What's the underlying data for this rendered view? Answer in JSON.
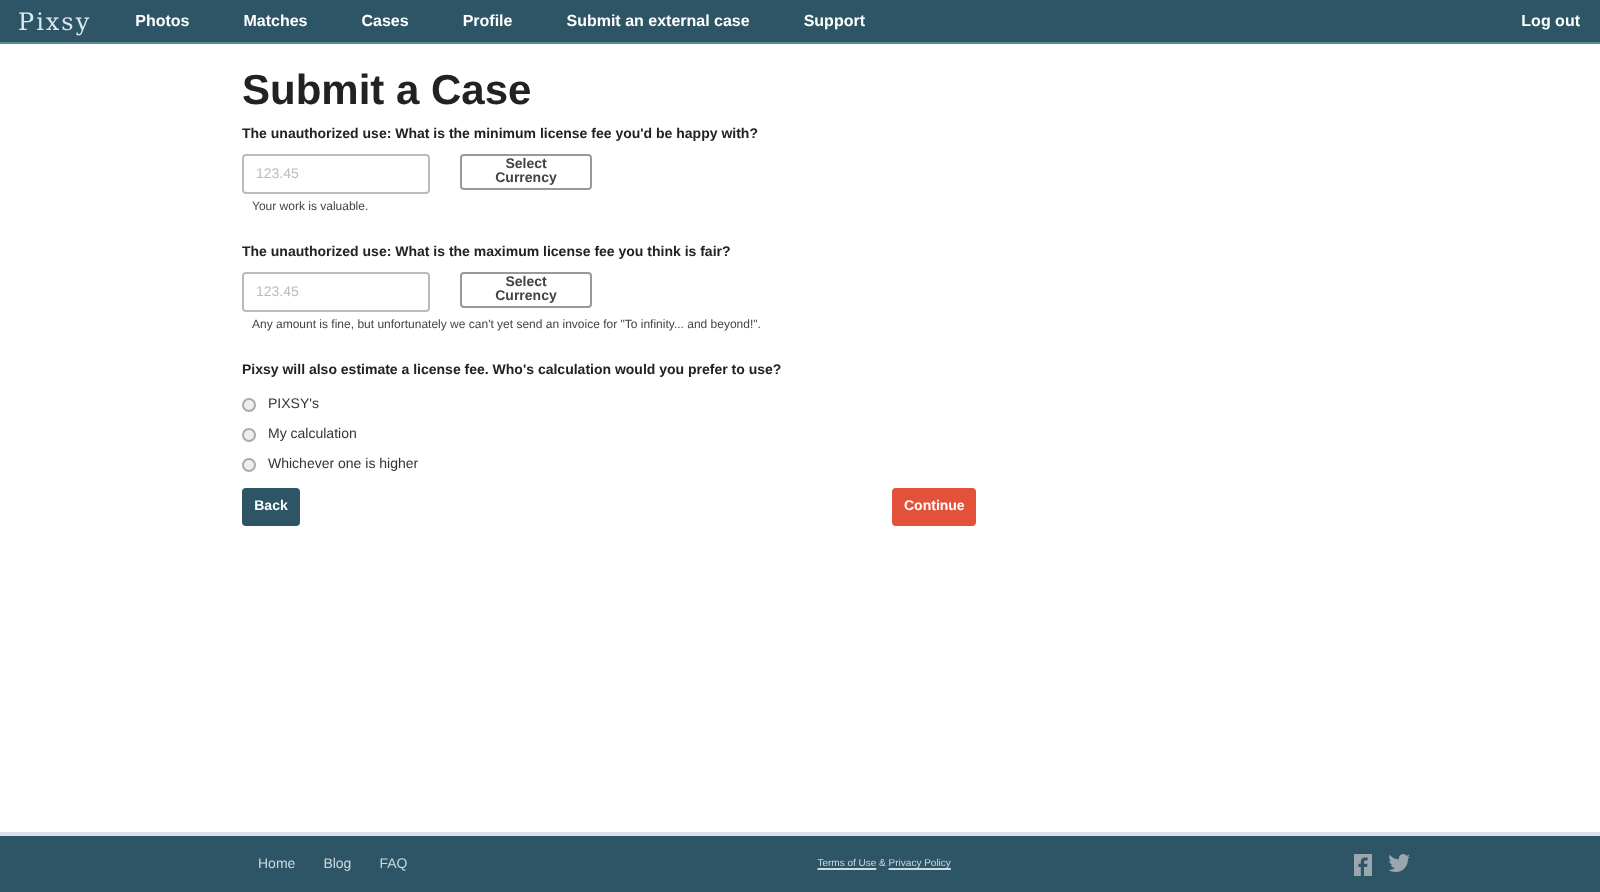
{
  "navbar": {
    "logo": "Pixsy",
    "links": [
      {
        "label": "Photos"
      },
      {
        "label": "Matches"
      },
      {
        "label": "Cases"
      },
      {
        "label": "Profile"
      },
      {
        "label": "Submit an external case"
      },
      {
        "label": "Support"
      }
    ],
    "logout": "Log out"
  },
  "page_title": "Submit a Case",
  "fee_questions": [
    {
      "question": "The unauthorized use: What is the minimum license fee you'd be happy with?",
      "amount_placeholder": "123.45",
      "currency": "Select Currency",
      "hint": "Your work is valuable."
    },
    {
      "question": "The unauthorized use: What is the maximum license fee you think is fair?",
      "amount_placeholder": "123.45",
      "currency": "Select Currency",
      "hint": "Any amount is fine, but unfortunately we can't yet send an invoice for \"To infinity... and beyond!\"."
    }
  ],
  "calculation_question": "Pixsy will also estimate a license fee. Who's calculation would you prefer to use?",
  "options": [
    {
      "label": "PIXSY's",
      "selected": false
    },
    {
      "label": "My calculation",
      "selected": false
    },
    {
      "label": "Whichever one is higher",
      "selected": false
    }
  ],
  "buttons": {
    "back": "Back",
    "continue": "Continue"
  },
  "footer": {
    "links": [
      {
        "label": "Home"
      },
      {
        "label": "Blog"
      },
      {
        "label": "FAQ"
      }
    ],
    "terms": "Terms of Use",
    "separator": "&",
    "privacy": "Privacy Policy"
  }
}
